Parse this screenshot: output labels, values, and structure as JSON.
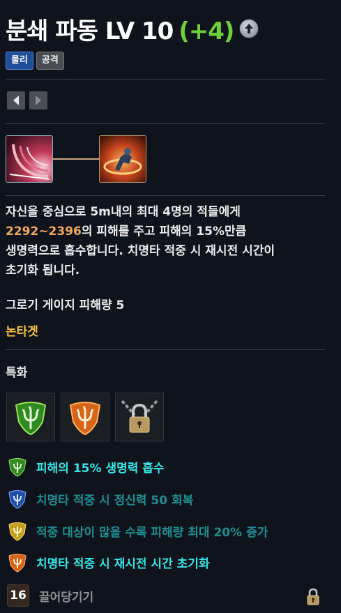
{
  "skill": {
    "name_level": "분쇄 파동 LV 10",
    "bonus": "(+4)"
  },
  "tags": [
    "물리",
    "공격"
  ],
  "description": {
    "line1": "자신을 중심으로 5m내의 최대 4명의 적들에게",
    "damage_range": "2292~2396",
    "line2_rest": "의 피해를 주고 피해의 15%만큼",
    "line3": "생명력으로 흡수합니다. 치명타 적중 시 재시전 시간이",
    "line4": "초기화 됩니다."
  },
  "stat_line": "그로기 게이지 피해량 5",
  "keyword": "논타겟",
  "specialization": {
    "label": "특화",
    "effects": [
      {
        "text": "피해의 15% 생명력 흡수",
        "tier": "green"
      },
      {
        "text": "치명타 적중 시 정신력 50 회복",
        "tier": "blue"
      },
      {
        "text": "적중 대상이 많을 수록 피해량 최대 20% 증가",
        "tier": "yellow"
      },
      {
        "text": "치명타 적중 시 재시전 시간 초기화",
        "tier": "orange"
      }
    ]
  },
  "locked_spec": {
    "level": "16",
    "name": "끌어당기기"
  },
  "colors": {
    "bonus": "#6fd13a",
    "damage": "#f2a65a",
    "keyword": "#f5c23c",
    "effect_bright": "#35e6e6",
    "effect_dim": "#1c8e92"
  }
}
